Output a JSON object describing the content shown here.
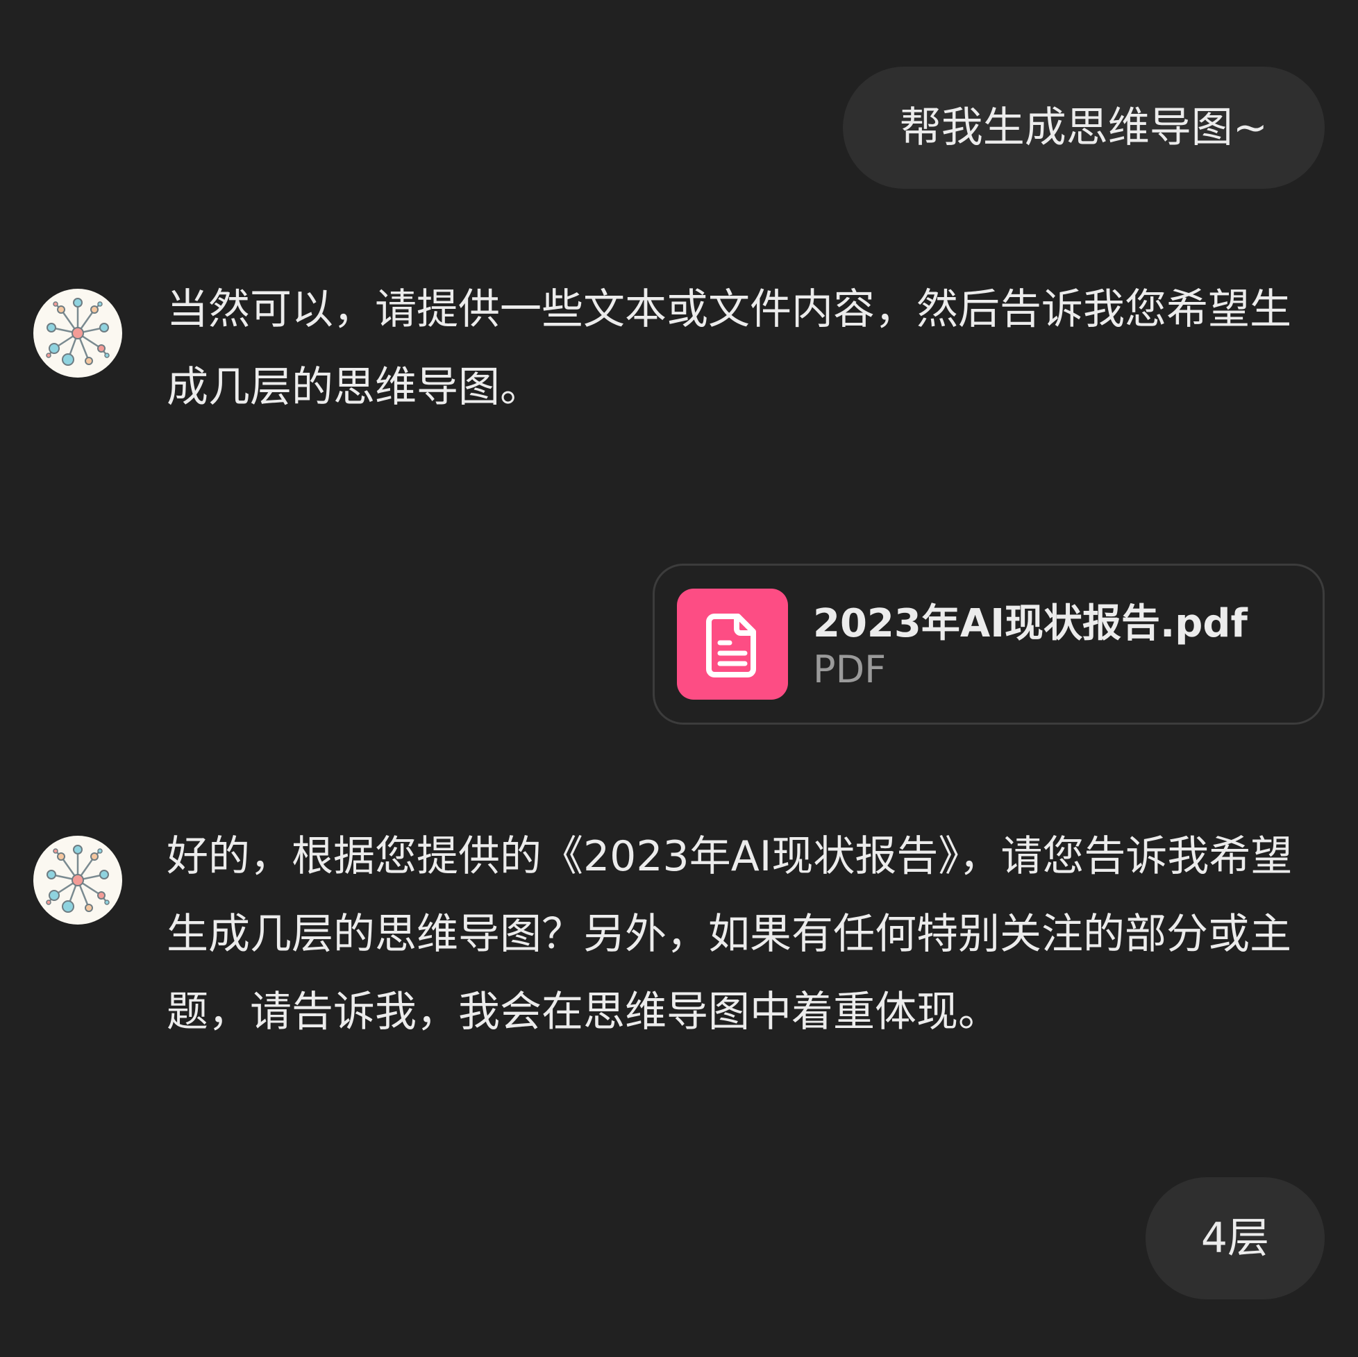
{
  "conversation": {
    "user_message_1": "帮我生成思维导图~",
    "assistant_message_1": "当然可以，请提供一些文本或文件内容，然后告诉我您希望生成几层的思维导图。",
    "attachment": {
      "file_name": "2023年AI现状报告.pdf",
      "file_type": "PDF",
      "icon": "file-document-icon",
      "icon_color": "#fd4d84"
    },
    "assistant_message_2": "好的，根据您提供的《2023年AI现状报告》，请您告诉我希望生成几层的思维导图？另外，如果有任何特别关注的部分或主题，请告诉我，我会在思维导图中着重体现。",
    "user_message_2": "4层"
  },
  "theme": {
    "background": "#212121",
    "bubble": "#2f2f2f",
    "text": "#ececec",
    "muted_text": "#9a9a9a"
  }
}
